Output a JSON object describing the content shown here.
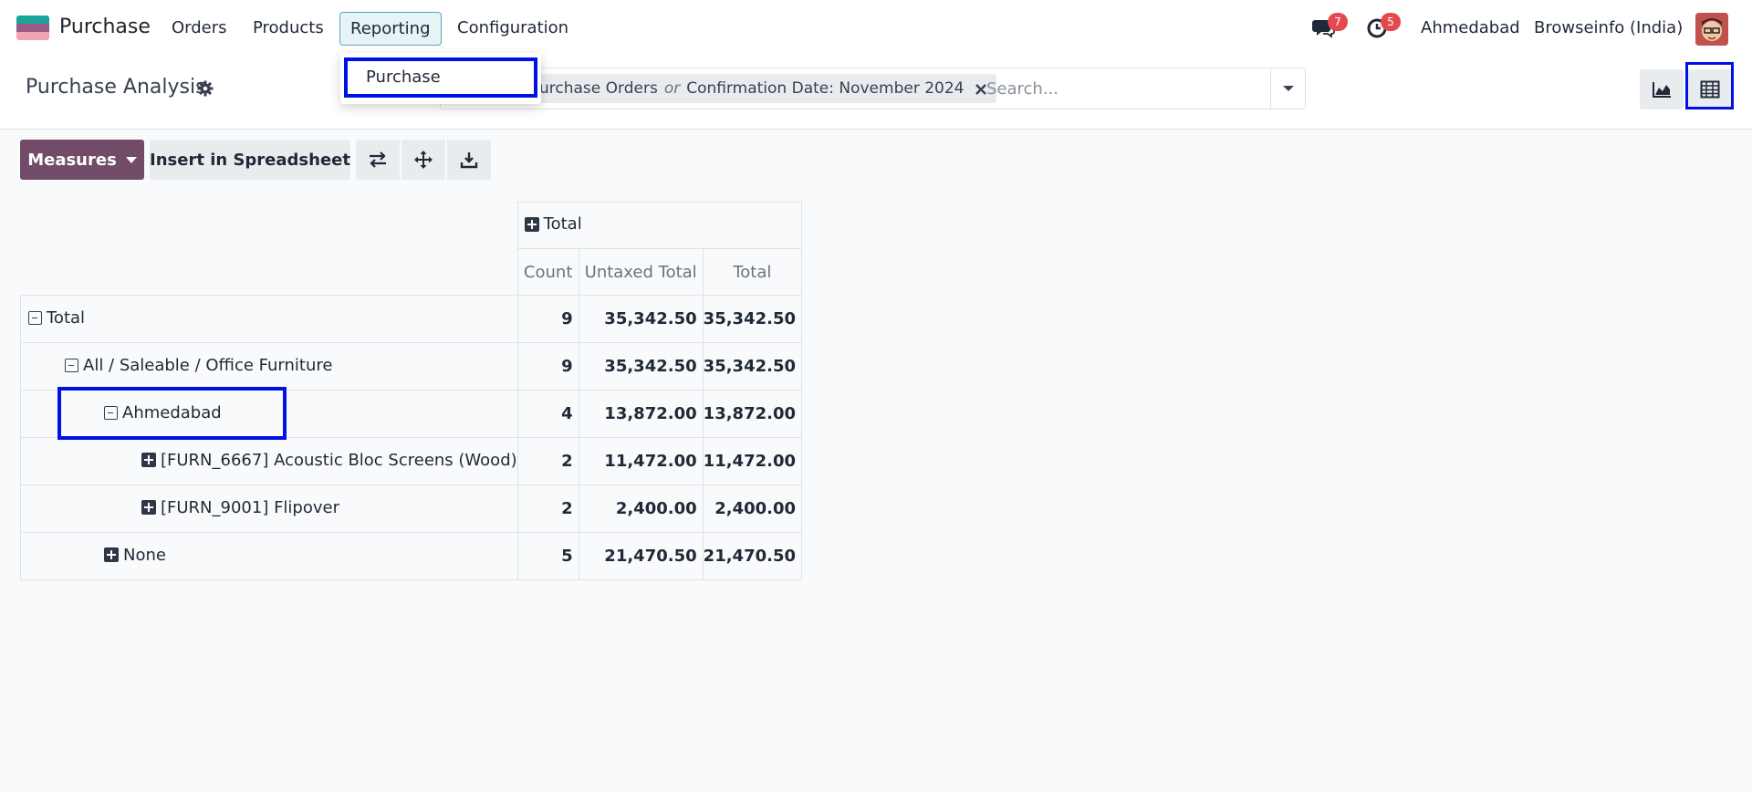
{
  "navbar": {
    "app_name": "Purchase",
    "menu": [
      {
        "label": "Orders"
      },
      {
        "label": "Products"
      },
      {
        "label": "Reporting"
      },
      {
        "label": "Configuration"
      }
    ],
    "messages_count": "7",
    "activities_count": "5",
    "location": "Ahmedabad",
    "company": "Browseinfo (India)",
    "accent_color": "#714b67",
    "badge_color": "#e5484d"
  },
  "dropdown": {
    "items": [
      {
        "label": "Purchase"
      }
    ]
  },
  "control_panel": {
    "title": "Purchase Analysis",
    "facet": {
      "part1": "urchase Orders",
      "connector": "or",
      "part2": "Confirmation Date: November 2024"
    },
    "search_placeholder": "Search..."
  },
  "toolbar": {
    "measures_label": "Measures",
    "spreadsheet_label": "Insert in Spreadsheet"
  },
  "pivot": {
    "column_group": "Total",
    "measures": [
      "Count",
      "Untaxed Total",
      "Total"
    ],
    "rows": [
      {
        "label": "Total",
        "count": "9",
        "untaxed": "35,342.50",
        "total": "35,342.50"
      },
      {
        "label": "All / Saleable / Office Furniture",
        "count": "9",
        "untaxed": "35,342.50",
        "total": "35,342.50"
      },
      {
        "label": "Ahmedabad",
        "count": "4",
        "untaxed": "13,872.00",
        "total": "13,872.00"
      },
      {
        "label": "[FURN_6667] Acoustic Bloc Screens (Wood)",
        "count": "2",
        "untaxed": "11,472.00",
        "total": "11,472.00"
      },
      {
        "label": "[FURN_9001] Flipover",
        "count": "2",
        "untaxed": "2,400.00",
        "total": "2,400.00"
      },
      {
        "label": "None",
        "count": "5",
        "untaxed": "21,470.50",
        "total": "21,470.50"
      }
    ]
  },
  "highlight_color": "#0011e6"
}
